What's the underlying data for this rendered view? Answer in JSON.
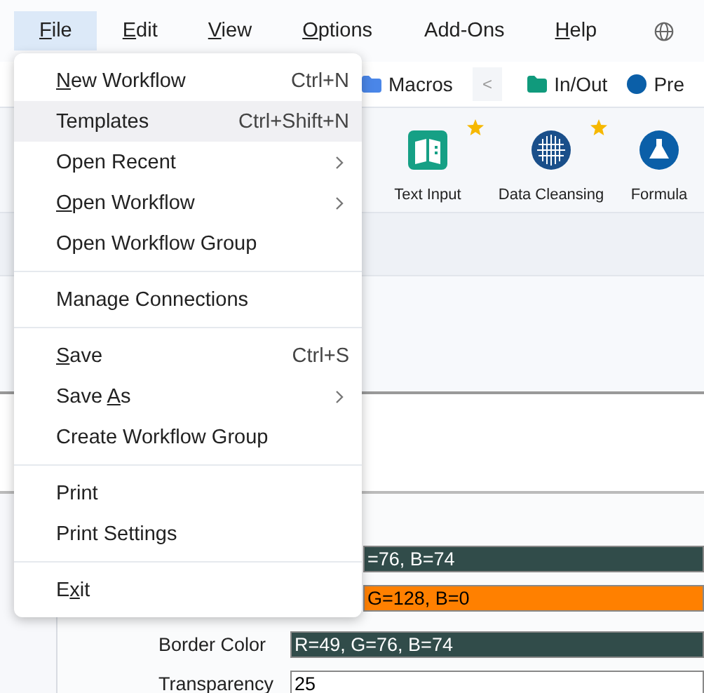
{
  "menu_bar": [
    {
      "label": {
        "key": "F",
        "post": "ile"
      },
      "selected": true
    },
    {
      "label": {
        "key": "E",
        "post": "dit"
      },
      "selected": false
    },
    {
      "label": {
        "key": "V",
        "post": "iew"
      },
      "selected": false
    },
    {
      "label": {
        "key": "O",
        "post": "ptions"
      },
      "selected": false
    },
    {
      "label": {
        "pre": "Add-Ons"
      },
      "selected": false
    },
    {
      "label": {
        "key": "H",
        "post": "elp"
      },
      "selected": false
    }
  ],
  "ribbon_tabs": [
    {
      "label": "Macros",
      "kind": "folder",
      "color": "#4a86e8"
    },
    {
      "label": "<",
      "kind": "scroll"
    },
    {
      "label": "In/Out",
      "kind": "folder",
      "color": "#109a7c"
    },
    {
      "label": "Pre",
      "kind": "dot",
      "color": "#0b5fa8"
    }
  ],
  "tools": [
    {
      "label": "Text Input",
      "favorite": true,
      "kind": "book",
      "color": "#16a085"
    },
    {
      "label": "Data Cleansing",
      "favorite": true,
      "kind": "globe",
      "color": "#1a4f8a"
    },
    {
      "label": "Formula",
      "favorite": false,
      "kind": "flask",
      "color": "#0b5fa8"
    }
  ],
  "properties": [
    {
      "value": "=76, B=74",
      "color": "#314c4a"
    },
    {
      "value": "G=128, B=0",
      "color": "#ff8000"
    },
    {
      "label": "Border Color",
      "value": "R=49, G=76, B=74",
      "color": "#314c4a"
    },
    {
      "label": "Transparency",
      "value": "25",
      "color": "#ffffff"
    }
  ],
  "file_menu": [
    [
      {
        "label": {
          "key": "N",
          "post": "ew Workflow"
        },
        "shortcut": "Ctrl+N",
        "kind": "command",
        "selected": false
      },
      {
        "label": {
          "pre": "Templates"
        },
        "shortcut": "Ctrl+Shift+N",
        "kind": "command",
        "selected": true
      },
      {
        "label": {
          "pre": "Open Recent"
        },
        "kind": "submenu",
        "selected": false
      },
      {
        "label": {
          "key": "O",
          "post": "pen Workflow"
        },
        "kind": "submenu",
        "selected": false
      },
      {
        "label": {
          "pre": "Open Workflow Group"
        },
        "kind": "command",
        "selected": false
      }
    ],
    [
      {
        "label": {
          "pre": "Manage Connections"
        },
        "kind": "command",
        "selected": false
      }
    ],
    [
      {
        "label": {
          "key": "S",
          "post": "ave"
        },
        "shortcut": "Ctrl+S",
        "kind": "command",
        "selected": false
      },
      {
        "label": {
          "pre": "Save ",
          "key": "A",
          "post": "s"
        },
        "kind": "submenu",
        "selected": false
      },
      {
        "label": {
          "pre": "Create Workflow Group"
        },
        "kind": "command",
        "selected": false
      }
    ],
    [
      {
        "label": {
          "pre": "Print"
        },
        "kind": "command",
        "selected": false
      },
      {
        "label": {
          "pre": "Print Settings"
        },
        "kind": "command",
        "selected": false
      }
    ],
    [
      {
        "label": {
          "pre": "E",
          "key": "x",
          "post": "it"
        },
        "kind": "command",
        "selected": false
      }
    ]
  ]
}
